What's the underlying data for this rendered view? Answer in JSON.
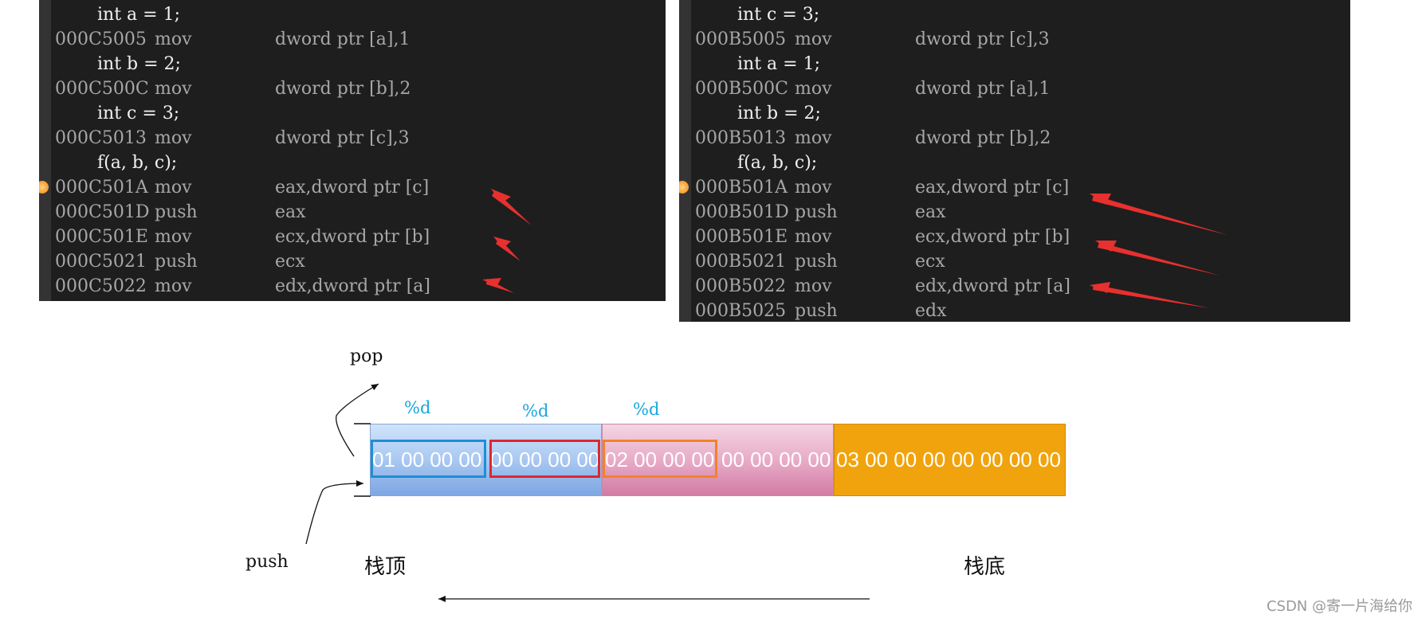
{
  "left_panel": {
    "lines": [
      {
        "kind": "src",
        "text": "int a = 1;"
      },
      {
        "kind": "asm",
        "addr": "000C5005",
        "op": "mov",
        "args": "dword ptr [a],1"
      },
      {
        "kind": "src",
        "text": "int b = 2;"
      },
      {
        "kind": "asm",
        "addr": "000C500C",
        "op": "mov",
        "args": "dword ptr [b],2"
      },
      {
        "kind": "src",
        "text": "int c = 3;"
      },
      {
        "kind": "asm",
        "addr": "000C5013",
        "op": "mov",
        "args": "dword ptr [c],3"
      },
      {
        "kind": "src",
        "text": "f(a, b, c);"
      },
      {
        "kind": "asm",
        "addr": "000C501A",
        "op": "mov",
        "args": "eax,dword ptr [c]"
      },
      {
        "kind": "asm",
        "addr": "000C501D",
        "op": "push",
        "args": "eax"
      },
      {
        "kind": "asm",
        "addr": "000C501E",
        "op": "mov",
        "args": "ecx,dword ptr [b]"
      },
      {
        "kind": "asm",
        "addr": "000C5021",
        "op": "push",
        "args": "ecx"
      },
      {
        "kind": "asm",
        "addr": "000C5022",
        "op": "mov",
        "args": "edx,dword ptr [a]"
      }
    ]
  },
  "right_panel": {
    "lines": [
      {
        "kind": "src",
        "text": "int c = 3;"
      },
      {
        "kind": "asm",
        "addr": "000B5005",
        "op": "mov",
        "args": "dword ptr [c],3"
      },
      {
        "kind": "src",
        "text": "int a = 1;"
      },
      {
        "kind": "asm",
        "addr": "000B500C",
        "op": "mov",
        "args": "dword ptr [a],1"
      },
      {
        "kind": "src",
        "text": "int b = 2;"
      },
      {
        "kind": "asm",
        "addr": "000B5013",
        "op": "mov",
        "args": "dword ptr [b],2"
      },
      {
        "kind": "src",
        "text": "f(a, b, c);"
      },
      {
        "kind": "asm",
        "addr": "000B501A",
        "op": "mov",
        "args": "eax,dword ptr [c]"
      },
      {
        "kind": "asm",
        "addr": "000B501D",
        "op": "push",
        "args": "eax"
      },
      {
        "kind": "asm",
        "addr": "000B501E",
        "op": "mov",
        "args": "ecx,dword ptr [b]"
      },
      {
        "kind": "asm",
        "addr": "000B5021",
        "op": "push",
        "args": "ecx"
      },
      {
        "kind": "asm",
        "addr": "000B5022",
        "op": "mov",
        "args": "edx,dword ptr [a]"
      },
      {
        "kind": "asm",
        "addr": "000B5025",
        "op": "push",
        "args": "edx"
      }
    ]
  },
  "diagram": {
    "pop_label": "pop",
    "push_label": "push",
    "stack_top_label": "栈顶",
    "stack_bottom_label": "栈底",
    "format_labels": [
      "%d",
      "%d",
      "%d"
    ],
    "block_texts": {
      "b1_a": "01 00 00 00",
      "b1_b": "00 00 00 00",
      "b2_a": "02 00 00 00",
      "b2_b": "00 00 00 00",
      "b3": "03 00 00 00 00 00 00 00"
    },
    "colors": {
      "block_blue": "#a9c8f1",
      "block_pink": "#e6a8c4",
      "block_orange": "#f1a30d",
      "highlight_blue": "#1e8ed4",
      "highlight_red": "#e0262e",
      "highlight_orange": "#f2822a",
      "format_label": "#19a7dc",
      "annotation_arrow": "#e8302e"
    }
  },
  "watermark": "CSDN @寄一片海给你"
}
